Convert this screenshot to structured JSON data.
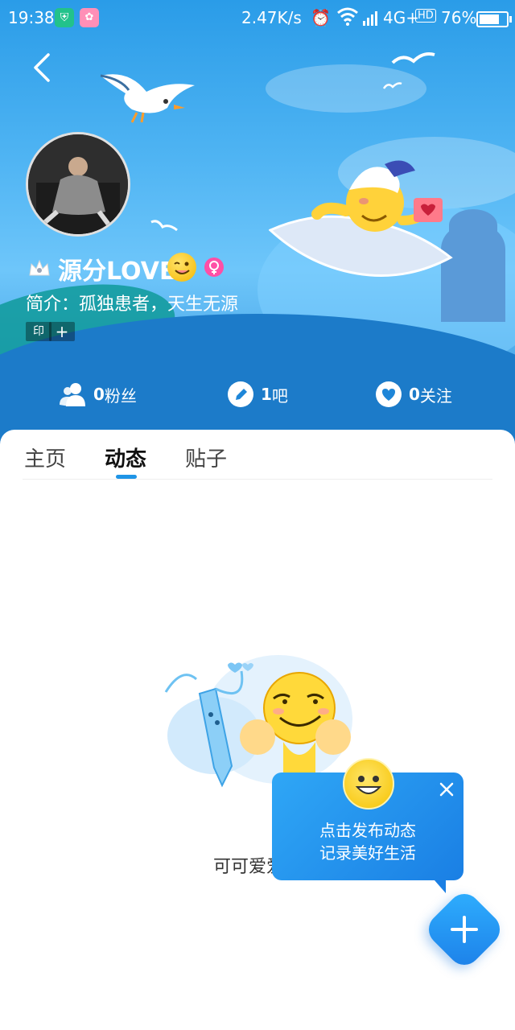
{
  "status_bar": {
    "time": "19:38",
    "net_speed": "2.47K/s",
    "network": "4G+",
    "hd": "HD",
    "battery": "76%",
    "battery_level": 0.76
  },
  "profile": {
    "nickname": "源分LOVE",
    "bio": "简介：孤独患者，天生无源",
    "tags": [
      "印",
      "+"
    ]
  },
  "stats": [
    {
      "num": "0",
      "label": "粉丝",
      "icon": "people-icon"
    },
    {
      "num": "1",
      "label": "吧",
      "icon": "pencil-icon"
    },
    {
      "num": "0",
      "label": "关注",
      "icon": "heart-icon"
    }
  ],
  "tabs": [
    {
      "label": "主页"
    },
    {
      "label": "动态",
      "active": true
    },
    {
      "label": "贴子"
    }
  ],
  "empty_state": {
    "text": "可可爱爱，"
  },
  "tip": {
    "line1": "点击发布动态",
    "line2": "记录美好生活"
  },
  "colors": {
    "accent": "#1e94e6",
    "header_top": "#2a9ce8",
    "fab": "#2fb0ff"
  }
}
